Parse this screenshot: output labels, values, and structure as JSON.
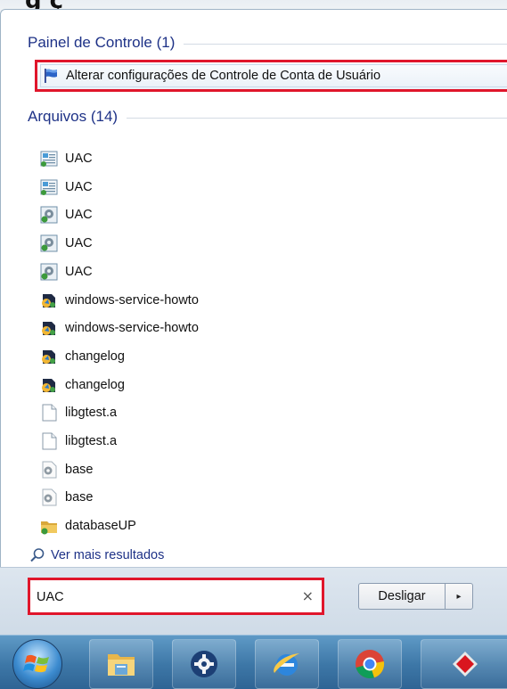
{
  "top_partial_text": "g ç",
  "control_panel": {
    "title": "Painel de Controle (1)",
    "result_label": "Alterar configurações de Controle de Conta de Usuário",
    "result_icon": "uac-flag-icon"
  },
  "files": {
    "title": "Arquivos (14)",
    "items": [
      {
        "label": "UAC",
        "icon": "document-icon"
      },
      {
        "label": "UAC",
        "icon": "document-icon"
      },
      {
        "label": "UAC",
        "icon": "settings-file-icon"
      },
      {
        "label": "UAC",
        "icon": "settings-file-icon"
      },
      {
        "label": "UAC",
        "icon": "settings-file-icon"
      },
      {
        "label": "windows-service-howto",
        "icon": "media-file-icon"
      },
      {
        "label": "windows-service-howto",
        "icon": "media-file-icon"
      },
      {
        "label": "changelog",
        "icon": "media-file-icon"
      },
      {
        "label": "changelog",
        "icon": "media-file-icon"
      },
      {
        "label": "libgtest.a",
        "icon": "blank-file-icon"
      },
      {
        "label": "libgtest.a",
        "icon": "blank-file-icon"
      },
      {
        "label": "base",
        "icon": "gear-file-icon"
      },
      {
        "label": "base",
        "icon": "gear-file-icon"
      },
      {
        "label": "databaseUP",
        "icon": "database-folder-icon"
      }
    ]
  },
  "more_results": "Ver mais resultados",
  "search": {
    "value": "UAC",
    "clear_symbol": "×"
  },
  "shutdown": {
    "label": "Desligar",
    "arrow": "▸"
  },
  "taskbar": {
    "items": [
      "start-orb",
      "file-explorer-icon",
      "settings-gear-icon",
      "ie-icon",
      "chrome-icon",
      "red-app-icon"
    ]
  }
}
